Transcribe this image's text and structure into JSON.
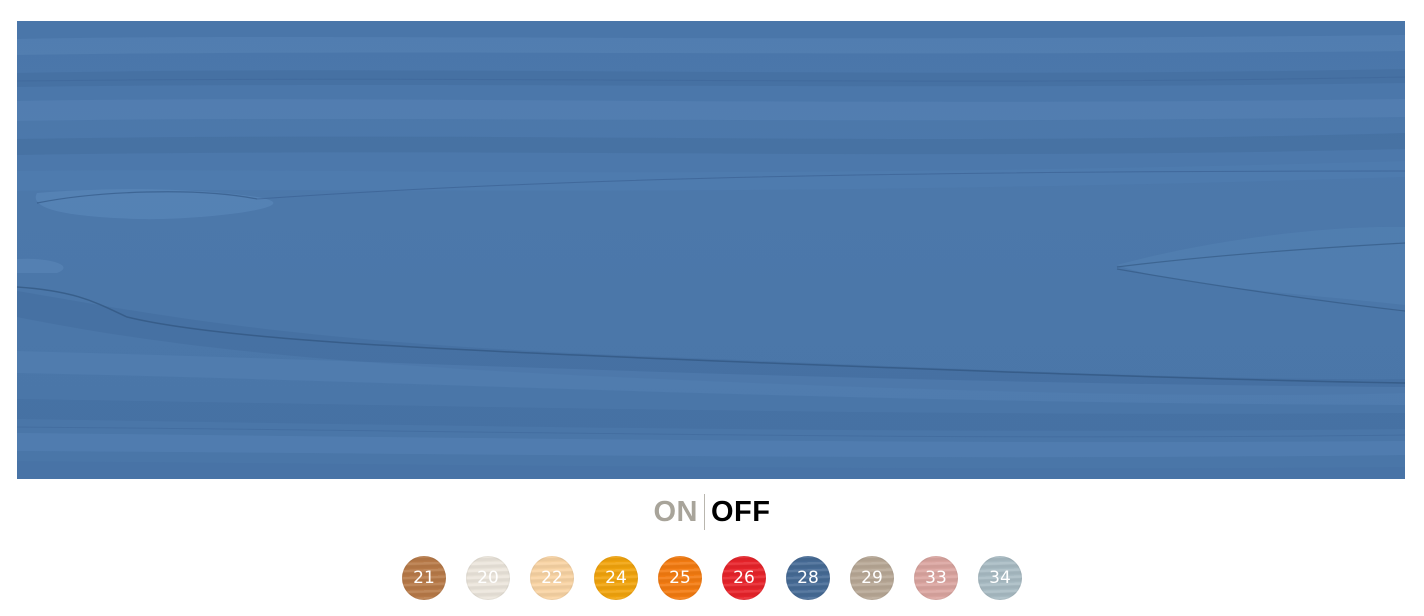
{
  "preview": {
    "texture": "blue-wood-grain",
    "color": "#4a76a9"
  },
  "toggle": {
    "on_label": "ON",
    "off_label": "OFF",
    "selected": "OFF"
  },
  "swatches": [
    {
      "label": "21",
      "color": "#b87a48"
    },
    {
      "label": "20",
      "color": "#ece6dc"
    },
    {
      "label": "22",
      "color": "#f9d4a4"
    },
    {
      "label": "24",
      "color": "#f2a40c"
    },
    {
      "label": "25",
      "color": "#f47b10"
    },
    {
      "label": "26",
      "color": "#e8232a"
    },
    {
      "label": "28",
      "color": "#466b96"
    },
    {
      "label": "29",
      "color": "#b8a896"
    },
    {
      "label": "33",
      "color": "#dba5a0"
    },
    {
      "label": "34",
      "color": "#a9bcc4"
    }
  ]
}
